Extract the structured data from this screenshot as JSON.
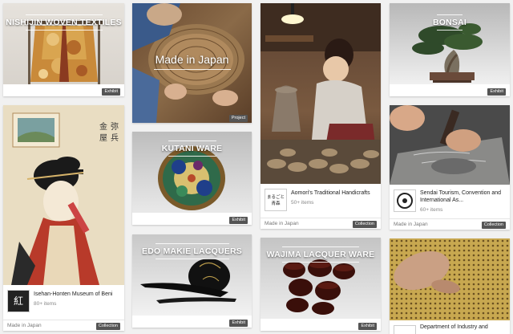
{
  "cards": {
    "nishijin": {
      "title": "NISHIJIN WOVEN TEXTILES",
      "badge": "Exhibit"
    },
    "beni": {
      "provider": "Isehan-Honten Museum of Beni",
      "count": "80+ items",
      "location": "Made in Japan",
      "badge": "Collection",
      "thumb_text": "紅"
    },
    "made_in_japan": {
      "title": "Made in Japan",
      "badge": "Project"
    },
    "kutani": {
      "title": "KUTANI WARE",
      "badge": "Exhibit"
    },
    "edo": {
      "title": "EDO MAKIE LACQUERS",
      "badge": "Exhibit"
    },
    "aomori": {
      "provider": "Aomori's Traditional Handicrafts",
      "count": "50+ items",
      "location": "Made in Japan",
      "badge": "Collection",
      "thumb_text": "まるごと青森"
    },
    "wajima": {
      "title": "WAJIMA LACQUER WARE",
      "badge": "Exhibit"
    },
    "bonsai": {
      "title": "BONSAI",
      "badge": "Exhibit"
    },
    "sendai": {
      "provider": "Sendai Tourism, Convention and International As...",
      "count": "60+ items",
      "location": "Made in Japan",
      "badge": "Collection"
    },
    "dept": {
      "provider": "Department of Industry and"
    }
  },
  "colors": {
    "badge": "#555555",
    "page_bg": "#f1f1f1"
  }
}
